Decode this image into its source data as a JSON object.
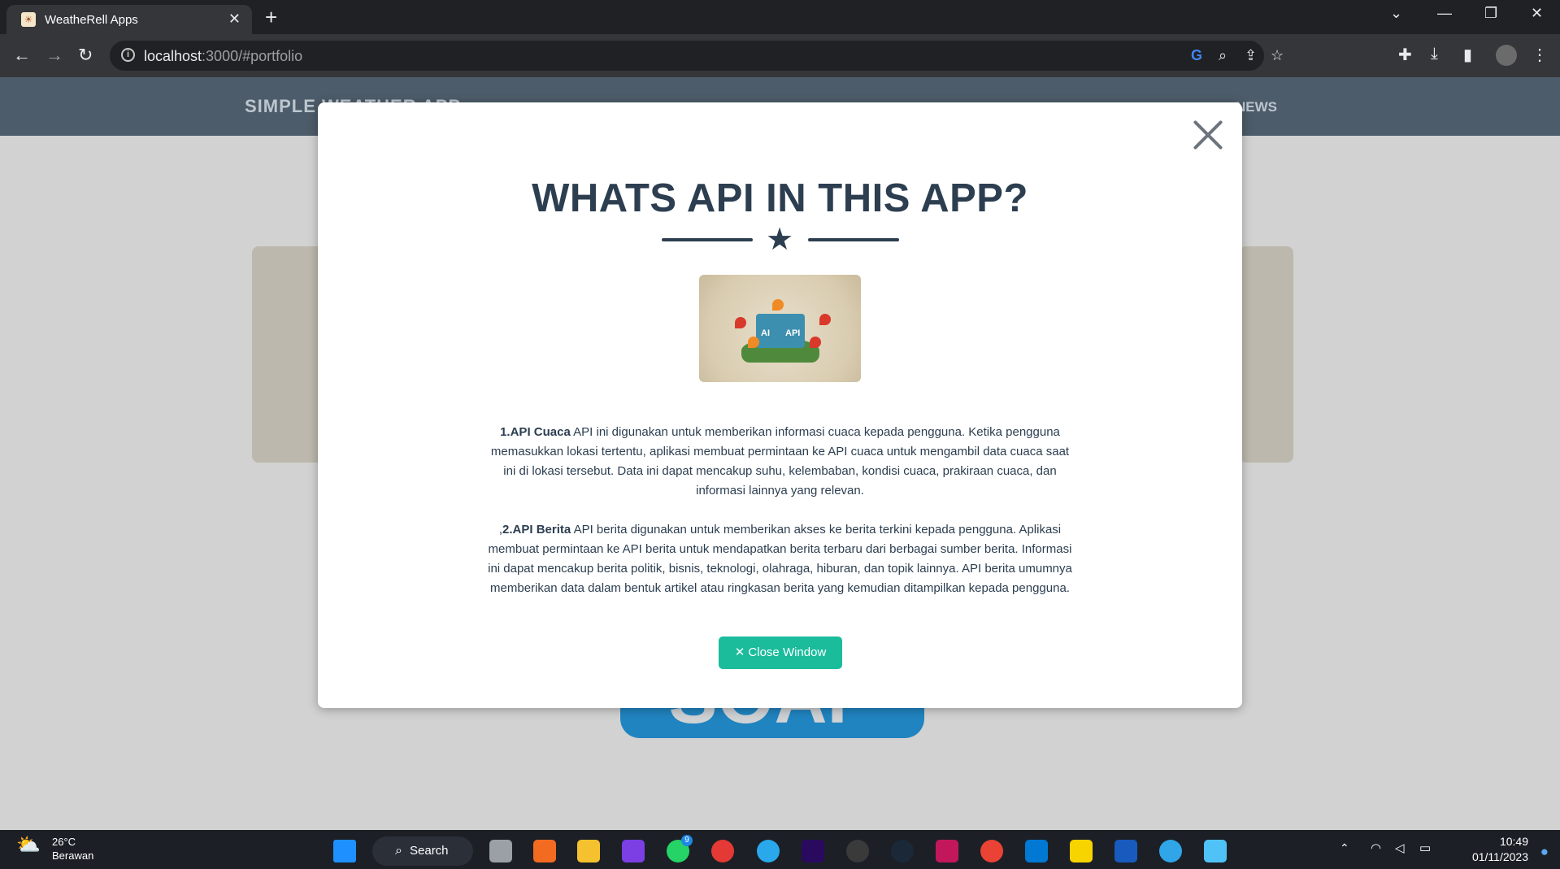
{
  "browser": {
    "tab_title": "WeatheRell Apps",
    "tab_close": "✕",
    "new_tab": "+",
    "url_host": "localhost",
    "url_path": ":3000/#portfolio"
  },
  "site": {
    "brand": "SIMPLE WEATHER APP",
    "nav_news": "NEWS",
    "soap_label": "SOAP"
  },
  "modal": {
    "title": "WHATS API IN THIS APP?",
    "image_labels": [
      "AI",
      "API"
    ],
    "paragraphs": [
      {
        "lead": "1.API Cuaca",
        "text": " API ini digunakan untuk memberikan informasi cuaca kepada pengguna. Ketika pengguna memasukkan lokasi tertentu, aplikasi membuat permintaan ke API cuaca untuk mengambil data cuaca saat ini di lokasi tersebut. Data ini dapat mencakup suhu, kelembaban, kondisi cuaca, prakiraan cuaca, dan informasi lainnya yang relevan."
      },
      {
        "prefix": ",",
        "lead": "2.API Berita",
        "text": " API berita digunakan untuk memberikan akses ke berita terkini kepada pengguna. Aplikasi membuat permintaan ke API berita untuk mendapatkan berita terbaru dari berbagai sumber berita. Informasi ini dapat mencakup berita politik, bisnis, teknologi, olahraga, hiburan, dan topik lainnya. API berita umumnya memberikan data dalam bentuk artikel atau ringkasan berita yang kemudian ditampilkan kepada pengguna."
      }
    ],
    "close_button": "✕ Close Window"
  },
  "taskbar": {
    "temp": "26°C",
    "condition": "Berawan",
    "search_label": "Search",
    "time": "10:49",
    "date": "01/11/2023",
    "whatsapp_badge": "9"
  },
  "colors": {
    "accent": "#1abc9c",
    "primary": "#2c3e50",
    "soap": "#0277bd"
  }
}
